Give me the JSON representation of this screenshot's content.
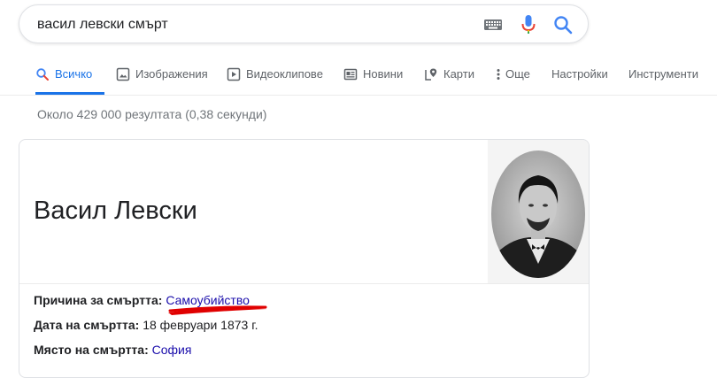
{
  "search": {
    "query": "васил левски смърт"
  },
  "icons": {
    "keyboard": "keyboard-icon",
    "mic": "microphone-icon",
    "search": "search-icon"
  },
  "tabs": [
    {
      "label": "Всичко",
      "icon": "search-icon",
      "active": true
    },
    {
      "label": "Изображения",
      "icon": "image-icon"
    },
    {
      "label": "Видеоклипове",
      "icon": "video-icon"
    },
    {
      "label": "Новини",
      "icon": "news-icon"
    },
    {
      "label": "Карти",
      "icon": "map-pin-icon"
    },
    {
      "label": "Още",
      "icon": "more-vertical-icon"
    },
    {
      "label": "Настройки"
    },
    {
      "label": "Инструменти"
    }
  ],
  "stats": "Около 429 000 резултата (0,38 секунди)",
  "knowledge_panel": {
    "title": "Васил Левски",
    "facts": [
      {
        "label": "Причина за смъртта:",
        "value": "Самоубийство",
        "link": true
      },
      {
        "label": "Дата на смъртта:",
        "value": "18 февруари 1873 г.",
        "link": false
      },
      {
        "label": "Място на смъртта:",
        "value": "София",
        "link": true
      }
    ]
  },
  "colors": {
    "accent": "#1a73e8",
    "link": "#1a0dab",
    "annotation": "#e00000"
  }
}
